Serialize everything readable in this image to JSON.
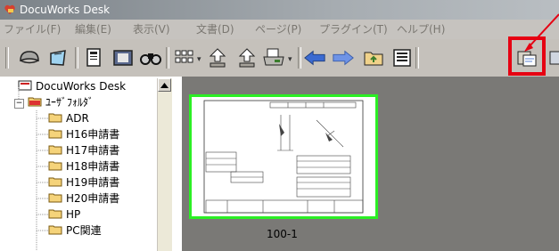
{
  "window": {
    "title": "DocuWorks Desk"
  },
  "menu": [
    "ファイル(F)",
    "編集(E)",
    "表示(V)",
    "文書(D)",
    "ページ(P)",
    "プラグイン(T)",
    "ヘルプ(H)"
  ],
  "toolbar": {
    "buttons": [
      "open-icon",
      "bind-icon",
      "document-info-icon",
      "viewer-icon",
      "find-icon",
      "view-mode-icon",
      "stack-left-icon",
      "stack-right-icon",
      "print-icon",
      "back-icon",
      "forward-icon",
      "folder-up-icon",
      "properties-icon",
      "highlighted-plugin-icon",
      "next-plugin-icon"
    ],
    "highlight_color": "#e60012"
  },
  "tree": {
    "root": "DocuWorks Desk",
    "user_folder": "ﾕｰｻﾞﾌｫﾙﾀﾞ",
    "folders": [
      "ADR",
      "H16申請書",
      "H17申請書",
      "H18申請書",
      "H19申請書",
      "H20申請書",
      "HP",
      "PC関連"
    ]
  },
  "workspace": {
    "thumbnail_caption": "100-1",
    "thumbnail_border_color": "#2bef24"
  }
}
